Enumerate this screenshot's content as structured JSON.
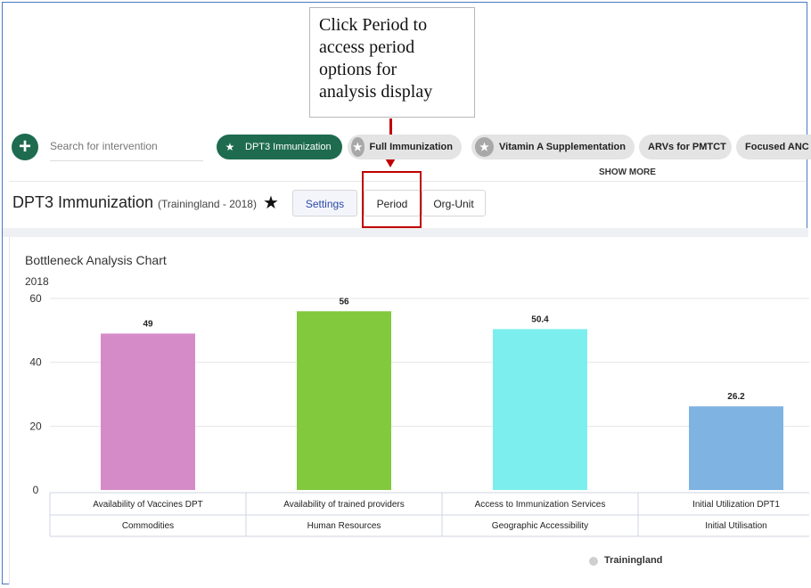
{
  "callout": {
    "lines": [
      "Click Period to",
      "access period",
      "options for",
      "analysis display"
    ]
  },
  "search": {
    "placeholder": "Search for intervention"
  },
  "chips": [
    {
      "label": "DPT3 Immunization",
      "active": true
    },
    {
      "label": "Full Immunization",
      "active": false
    },
    {
      "label": "Vitamin A Supplementation",
      "active": false
    },
    {
      "label": "ARVs for PMTCT",
      "active": false
    },
    {
      "label": "Focused ANC",
      "active": false
    }
  ],
  "show_more": "SHOW MORE",
  "header": {
    "title": "DPT3 Immunization",
    "subtitle": "(Trainingland - 2018)",
    "buttons": {
      "settings": "Settings",
      "period": "Period",
      "org_unit": "Org-Unit"
    }
  },
  "chart_card": {
    "title": "Bottleneck Analysis Chart",
    "subtitle": "2018"
  },
  "chart_data": {
    "type": "bar",
    "title": "Bottleneck Analysis Chart",
    "subtitle": "2018",
    "categories": [
      "Availability of Vaccines DPT",
      "Availability of trained providers",
      "Access to Immunization Services",
      "Initial Utilization DPT1"
    ],
    "groups": [
      "Commodities",
      "Human Resources",
      "Geographic Accessibility",
      "Initial Utilisation"
    ],
    "series": [
      {
        "name": "Trainingland",
        "values": [
          49,
          56,
          50.4,
          26.2
        ],
        "data_labels": [
          "49",
          "56",
          "50.4",
          "26.2"
        ]
      }
    ],
    "bar_colors": [
      "#d68bc9",
      "#82c93e",
      "#7ceeee",
      "#7fb3e2"
    ],
    "ylim": [
      0,
      60
    ],
    "yticks": [
      0,
      20,
      40,
      60
    ],
    "grid": true,
    "legend": {
      "position": "bottom",
      "entries": [
        "Trainingland"
      ],
      "color": "#cfcfcf"
    }
  },
  "colors": {
    "accent": "#1e6b4f",
    "highlight": "#c00000",
    "frame": "#4a78c2"
  }
}
